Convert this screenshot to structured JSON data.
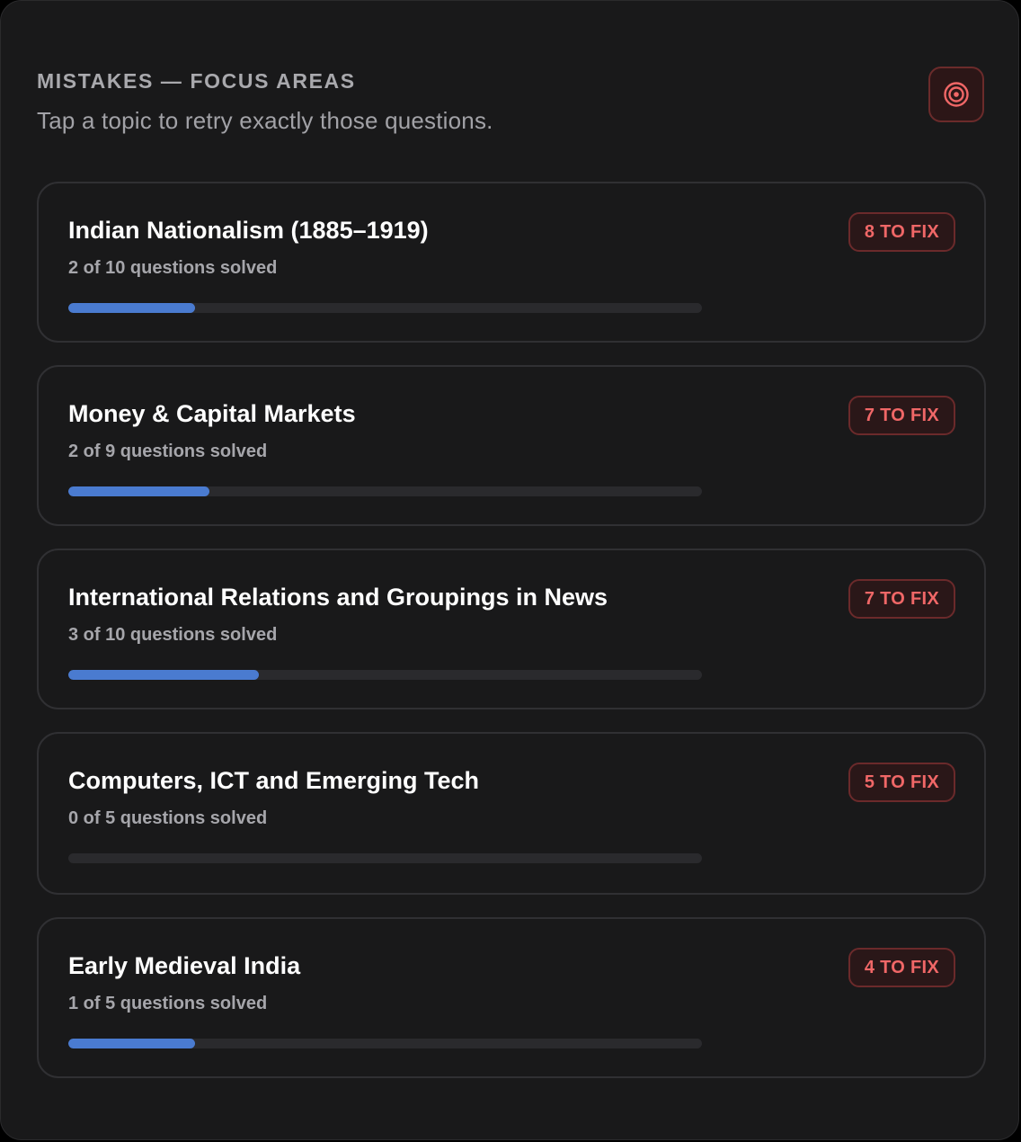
{
  "header": {
    "eyebrow": "MISTAKES — FOCUS AREAS",
    "subtitle": "Tap a topic to retry exactly those questions.",
    "action_icon": "target-icon"
  },
  "colors": {
    "background": "#19191a",
    "progress": "#4a7bd0",
    "badge_text": "#f06767",
    "badge_border": "#6b2a2b"
  },
  "topics": [
    {
      "title": "Indian Nationalism (1885–1919)",
      "solved_text": "2 of 10 questions solved",
      "badge": "8 TO FIX",
      "progress": 0.2
    },
    {
      "title": "Money & Capital Markets",
      "solved_text": "2 of 9 questions solved",
      "badge": "7 TO FIX",
      "progress": 0.222
    },
    {
      "title": "International Relations and Groupings in News",
      "solved_text": "3 of 10 questions solved",
      "badge": "7 TO FIX",
      "progress": 0.3
    },
    {
      "title": "Computers, ICT and Emerging Tech",
      "solved_text": "0 of 5 questions solved",
      "badge": "5 TO FIX",
      "progress": 0
    },
    {
      "title": "Early Medieval India",
      "solved_text": "1 of 5 questions solved",
      "badge": "4 TO FIX",
      "progress": 0.2
    }
  ]
}
